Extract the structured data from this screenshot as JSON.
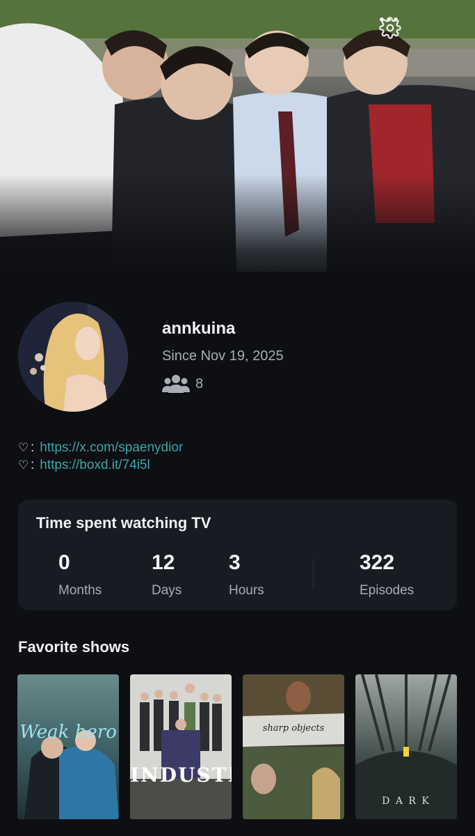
{
  "header": {
    "settings_icon": "gear-icon",
    "more_icon": "more-dots-icon"
  },
  "profile": {
    "username": "annkuina",
    "since": "Since Nov 19, 2025",
    "followers_icon": "users-icon",
    "followers_count": "8"
  },
  "links": [
    {
      "icon": "heart-outline-icon",
      "text": "https://x.com/spaenydior"
    },
    {
      "icon": "heart-outline-icon",
      "text": "https://boxd.it/74i5l"
    }
  ],
  "stats": {
    "title": "Time spent watching TV",
    "items": [
      {
        "value": "0",
        "unit": "Months"
      },
      {
        "value": "12",
        "unit": "Days"
      },
      {
        "value": "3",
        "unit": "Hours"
      },
      {
        "value": "322",
        "unit": "Episodes"
      }
    ]
  },
  "favorites": {
    "title": "Favorite shows",
    "shows": [
      {
        "poster_text": "Weak hero"
      },
      {
        "poster_text": "INDUSTRY"
      },
      {
        "poster_text": "sharp objects"
      },
      {
        "poster_text": "D A R K"
      }
    ]
  },
  "colors": {
    "background": "#0d0f12",
    "card": "#181c22",
    "link": "#3aa5ad",
    "muted_text": "#a9adb4"
  }
}
